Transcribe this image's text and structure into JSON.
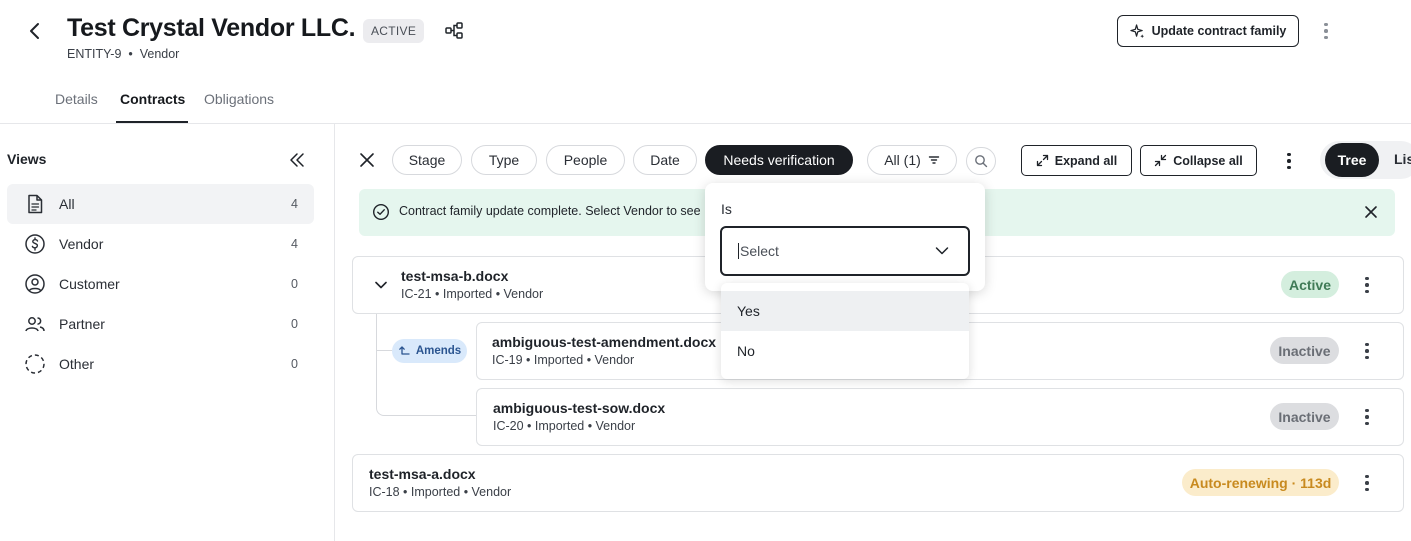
{
  "header": {
    "title": "Test Crystal Vendor LLC.",
    "status_badge": "ACTIVE",
    "entity_id": "ENTITY-9",
    "entity_type": "Vendor",
    "separator": "•",
    "update_button": "Update contract family"
  },
  "tabs": [
    {
      "label": "Details",
      "active": false
    },
    {
      "label": "Contracts",
      "active": true
    },
    {
      "label": "Obligations",
      "active": false
    }
  ],
  "sidebar": {
    "title": "Views",
    "items": [
      {
        "label": "All",
        "count": "4",
        "icon": "document-icon",
        "selected": true
      },
      {
        "label": "Vendor",
        "count": "4",
        "icon": "dollar-circle-icon",
        "selected": false
      },
      {
        "label": "Customer",
        "count": "0",
        "icon": "user-circle-icon",
        "selected": false
      },
      {
        "label": "Partner",
        "count": "0",
        "icon": "users-icon",
        "selected": false
      },
      {
        "label": "Other",
        "count": "0",
        "icon": "dashed-circle-icon",
        "selected": false
      }
    ]
  },
  "filters": {
    "chips": [
      "Stage",
      "Type",
      "People",
      "Date",
      "Needs verification"
    ],
    "all_filter": "All (1)",
    "expand_all": "Expand all",
    "collapse_all": "Collapse all",
    "view_tree": "Tree",
    "view_list": "Lis"
  },
  "banner": {
    "text": "Contract family update complete. Select Vendor to see"
  },
  "contracts": {
    "parent": {
      "name": "test-msa-b.docx",
      "meta": "IC-21 • Imported • Vendor",
      "status": "Active"
    },
    "relation_label": "Amends",
    "children": [
      {
        "name": "ambiguous-test-amendment.docx",
        "meta": "IC-19 • Imported • Vendor",
        "status": "Inactive"
      },
      {
        "name": "ambiguous-test-sow.docx",
        "meta": "IC-20 • Imported • Vendor",
        "status": "Inactive"
      }
    ],
    "standalone": {
      "name": "test-msa-a.docx",
      "meta": "IC-18 • Imported • Vendor",
      "status": "Auto-renewing · 113d"
    }
  },
  "dropdown": {
    "label": "Is",
    "placeholder": "Select",
    "options": [
      "Yes",
      "No"
    ],
    "highlighted": "Yes"
  },
  "colors": {
    "accent_dark": "#1a1d22",
    "banner_bg": "#e5f6ee",
    "status_active": "#d4eede",
    "status_inactive": "#dcdde0",
    "status_auto": "#fbeccb",
    "amends_bg": "#d9e9fb"
  }
}
